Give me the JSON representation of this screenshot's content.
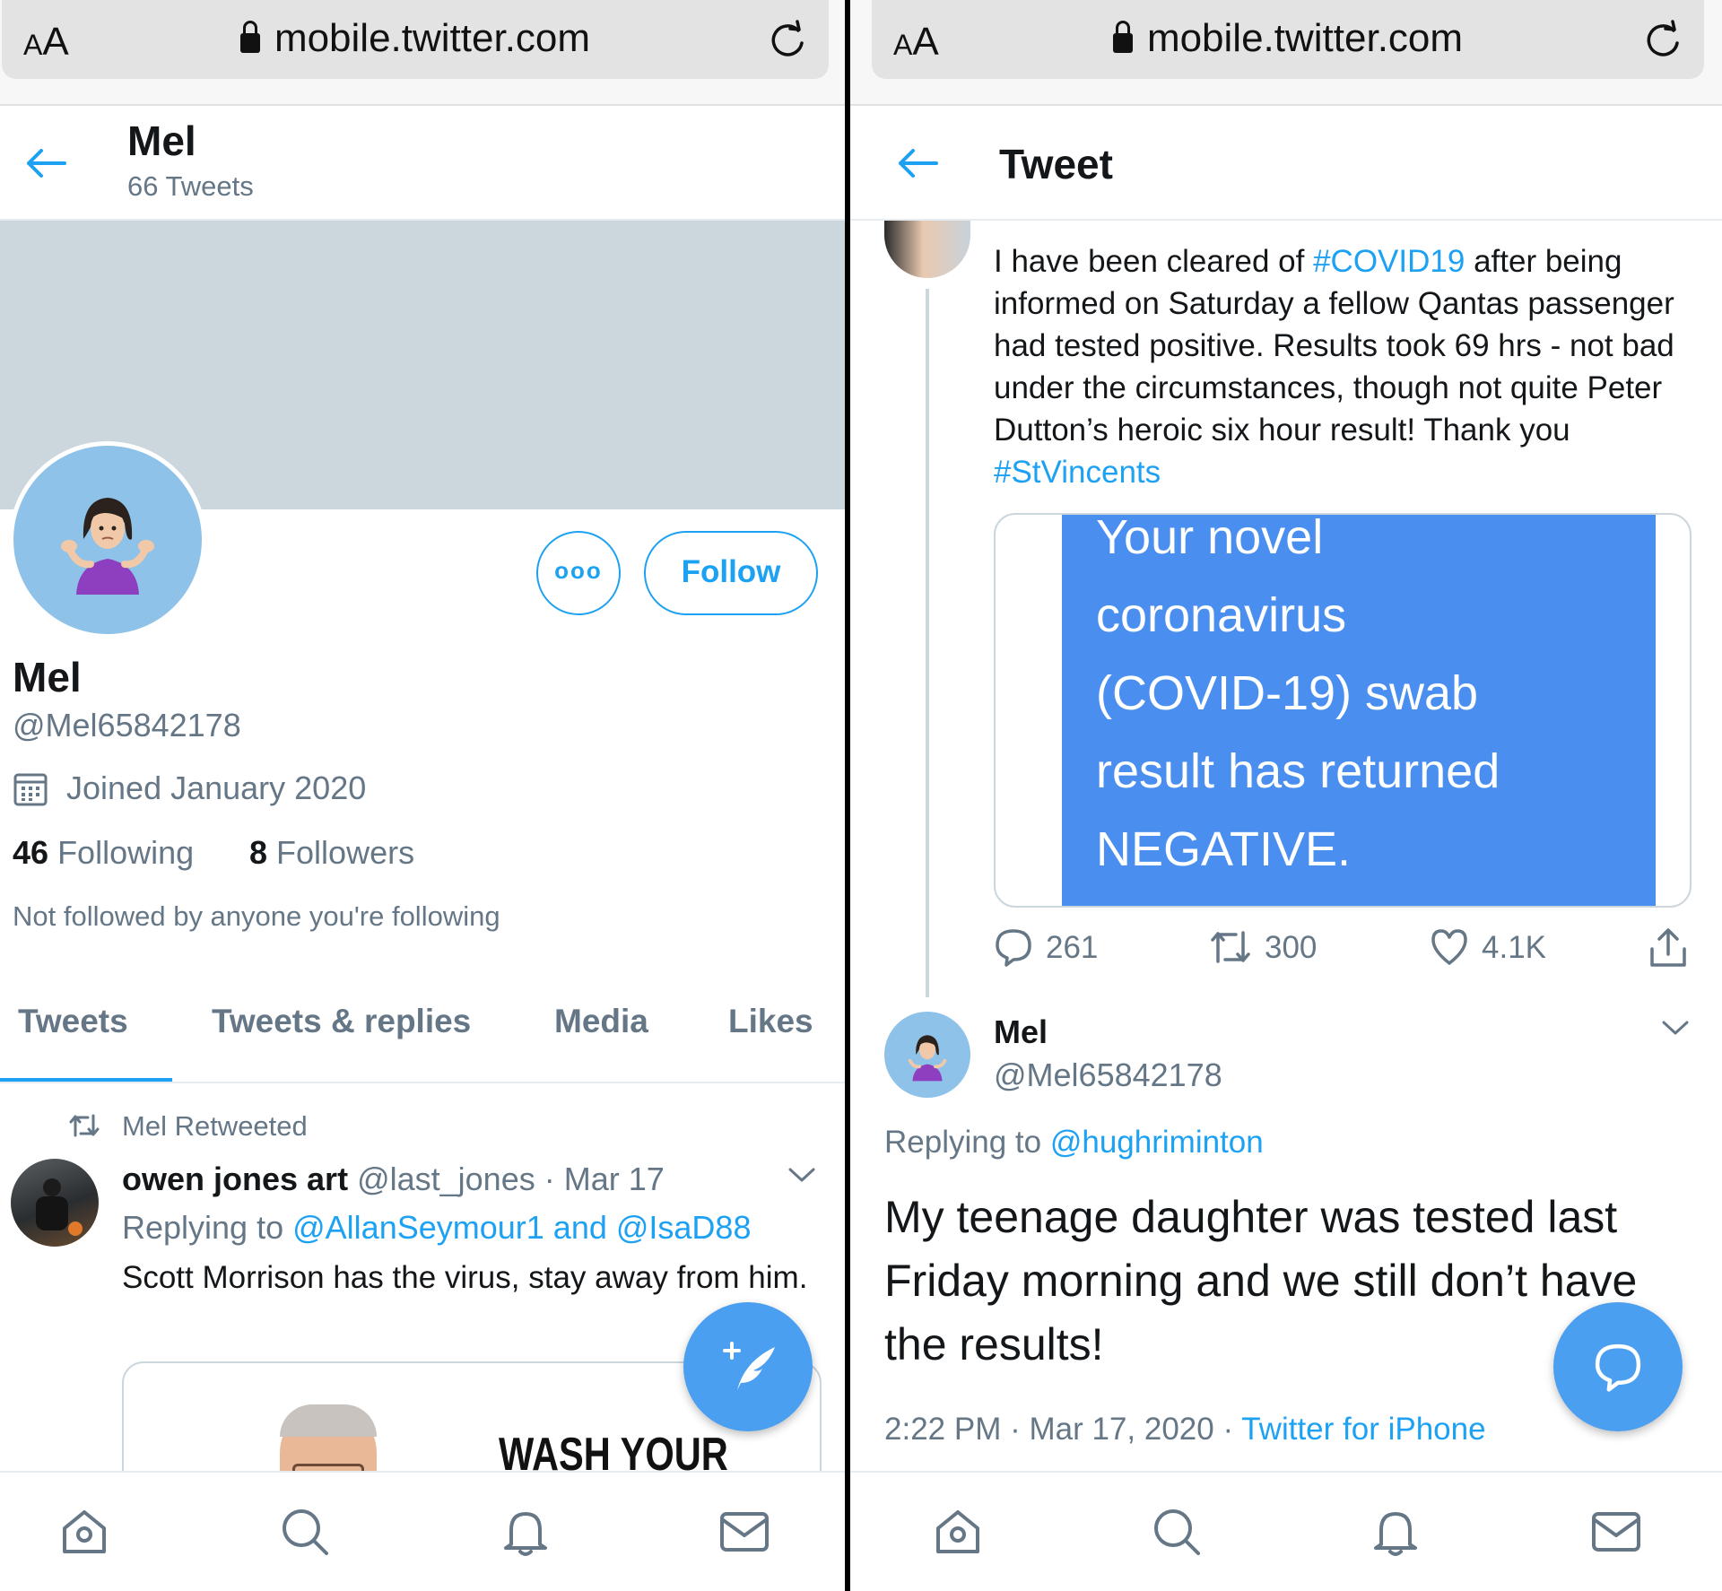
{
  "browser": {
    "aa_label": "A",
    "aa_label_big": "A",
    "url": "mobile.twitter.com"
  },
  "profile": {
    "header_name": "Mel",
    "header_tweets": "66 Tweets",
    "more_label": "ooo",
    "follow_label": "Follow",
    "name": "Mel",
    "handle": "@Mel65842178",
    "joined": "Joined January 2020",
    "following_count": "46",
    "following_label": "Following",
    "followers_count": "8",
    "followers_label": "Followers",
    "not_followed": "Not followed by anyone you're following",
    "tabs": [
      "Tweets",
      "Tweets & replies",
      "Media",
      "Likes"
    ]
  },
  "retweet": {
    "context": "Mel Retweeted",
    "author": "owen jones art",
    "handle": "@last_jones",
    "sep": "·",
    "date": "Mar 17",
    "replying_prefix": "Replying to",
    "replying_to": "@AllanSeymour1 and @IsaD88",
    "text": "Scott Morrison has the virus, stay away from him.",
    "image_text": "WASH YOUR"
  },
  "tweet_page": {
    "title": "Tweet",
    "parent_text_1": "I have been cleared of ",
    "parent_hashtag_1": "#COVID19",
    "parent_text_2": " after being informed on Saturday a fellow Qantas passenger had tested positive. Results took 69 hrs - not bad under the circumstances, though not quite Peter Dutton’s heroic six hour result! Thank you ",
    "parent_hashtag_2": "#StVincents",
    "image_text_lines": [
      "Your novel",
      "coronavirus",
      "(COVID-19) swab",
      "result has returned",
      "NEGATIVE."
    ],
    "replies": "261",
    "retweets": "300",
    "likes": "4.1K",
    "reply_name": "Mel",
    "reply_handle": "@Mel65842178",
    "replying_prefix": "Replying to",
    "replying_to": "@hughriminton",
    "reply_text": "My teenage daughter was tested last Friday morning and we still don’t have the results!",
    "time": "2:22 PM",
    "sep": "·",
    "date": "Mar 17, 2020",
    "sep2": "·",
    "source": "Twitter for iPhone"
  },
  "colors": {
    "accent": "#1da1f2",
    "muted": "#657786",
    "banner": "#ccd6dd",
    "avatar_bg": "#8fc2e8"
  }
}
